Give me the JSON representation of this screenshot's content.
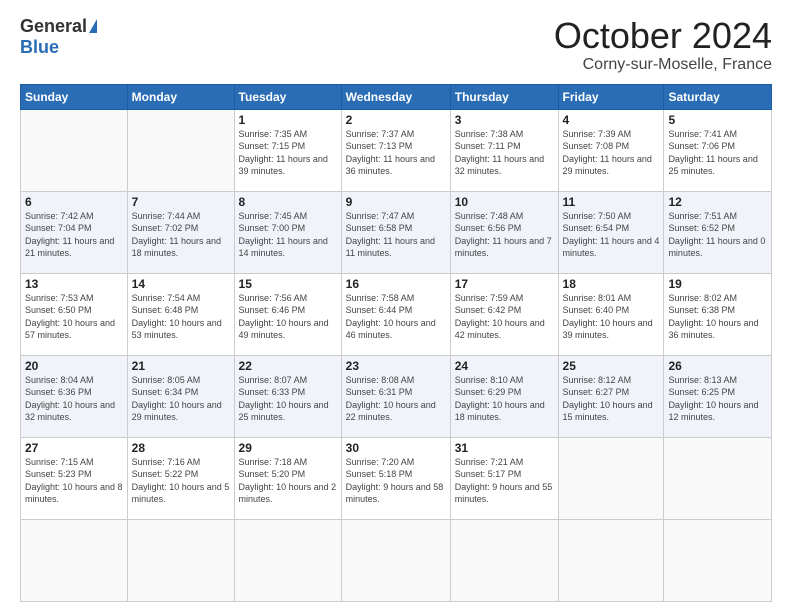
{
  "logo": {
    "general": "General",
    "blue": "Blue"
  },
  "header": {
    "month": "October 2024",
    "location": "Corny-sur-Moselle, France"
  },
  "weekdays": [
    "Sunday",
    "Monday",
    "Tuesday",
    "Wednesday",
    "Thursday",
    "Friday",
    "Saturday"
  ],
  "days": [
    {
      "num": "",
      "info": ""
    },
    {
      "num": "",
      "info": ""
    },
    {
      "num": "1",
      "info": "Sunrise: 7:35 AM\nSunset: 7:15 PM\nDaylight: 11 hours and 39 minutes."
    },
    {
      "num": "2",
      "info": "Sunrise: 7:37 AM\nSunset: 7:13 PM\nDaylight: 11 hours and 36 minutes."
    },
    {
      "num": "3",
      "info": "Sunrise: 7:38 AM\nSunset: 7:11 PM\nDaylight: 11 hours and 32 minutes."
    },
    {
      "num": "4",
      "info": "Sunrise: 7:39 AM\nSunset: 7:08 PM\nDaylight: 11 hours and 29 minutes."
    },
    {
      "num": "5",
      "info": "Sunrise: 7:41 AM\nSunset: 7:06 PM\nDaylight: 11 hours and 25 minutes."
    },
    {
      "num": "6",
      "info": "Sunrise: 7:42 AM\nSunset: 7:04 PM\nDaylight: 11 hours and 21 minutes."
    },
    {
      "num": "7",
      "info": "Sunrise: 7:44 AM\nSunset: 7:02 PM\nDaylight: 11 hours and 18 minutes."
    },
    {
      "num": "8",
      "info": "Sunrise: 7:45 AM\nSunset: 7:00 PM\nDaylight: 11 hours and 14 minutes."
    },
    {
      "num": "9",
      "info": "Sunrise: 7:47 AM\nSunset: 6:58 PM\nDaylight: 11 hours and 11 minutes."
    },
    {
      "num": "10",
      "info": "Sunrise: 7:48 AM\nSunset: 6:56 PM\nDaylight: 11 hours and 7 minutes."
    },
    {
      "num": "11",
      "info": "Sunrise: 7:50 AM\nSunset: 6:54 PM\nDaylight: 11 hours and 4 minutes."
    },
    {
      "num": "12",
      "info": "Sunrise: 7:51 AM\nSunset: 6:52 PM\nDaylight: 11 hours and 0 minutes."
    },
    {
      "num": "13",
      "info": "Sunrise: 7:53 AM\nSunset: 6:50 PM\nDaylight: 10 hours and 57 minutes."
    },
    {
      "num": "14",
      "info": "Sunrise: 7:54 AM\nSunset: 6:48 PM\nDaylight: 10 hours and 53 minutes."
    },
    {
      "num": "15",
      "info": "Sunrise: 7:56 AM\nSunset: 6:46 PM\nDaylight: 10 hours and 49 minutes."
    },
    {
      "num": "16",
      "info": "Sunrise: 7:58 AM\nSunset: 6:44 PM\nDaylight: 10 hours and 46 minutes."
    },
    {
      "num": "17",
      "info": "Sunrise: 7:59 AM\nSunset: 6:42 PM\nDaylight: 10 hours and 42 minutes."
    },
    {
      "num": "18",
      "info": "Sunrise: 8:01 AM\nSunset: 6:40 PM\nDaylight: 10 hours and 39 minutes."
    },
    {
      "num": "19",
      "info": "Sunrise: 8:02 AM\nSunset: 6:38 PM\nDaylight: 10 hours and 36 minutes."
    },
    {
      "num": "20",
      "info": "Sunrise: 8:04 AM\nSunset: 6:36 PM\nDaylight: 10 hours and 32 minutes."
    },
    {
      "num": "21",
      "info": "Sunrise: 8:05 AM\nSunset: 6:34 PM\nDaylight: 10 hours and 29 minutes."
    },
    {
      "num": "22",
      "info": "Sunrise: 8:07 AM\nSunset: 6:33 PM\nDaylight: 10 hours and 25 minutes."
    },
    {
      "num": "23",
      "info": "Sunrise: 8:08 AM\nSunset: 6:31 PM\nDaylight: 10 hours and 22 minutes."
    },
    {
      "num": "24",
      "info": "Sunrise: 8:10 AM\nSunset: 6:29 PM\nDaylight: 10 hours and 18 minutes."
    },
    {
      "num": "25",
      "info": "Sunrise: 8:12 AM\nSunset: 6:27 PM\nDaylight: 10 hours and 15 minutes."
    },
    {
      "num": "26",
      "info": "Sunrise: 8:13 AM\nSunset: 6:25 PM\nDaylight: 10 hours and 12 minutes."
    },
    {
      "num": "27",
      "info": "Sunrise: 7:15 AM\nSunset: 5:23 PM\nDaylight: 10 hours and 8 minutes."
    },
    {
      "num": "28",
      "info": "Sunrise: 7:16 AM\nSunset: 5:22 PM\nDaylight: 10 hours and 5 minutes."
    },
    {
      "num": "29",
      "info": "Sunrise: 7:18 AM\nSunset: 5:20 PM\nDaylight: 10 hours and 2 minutes."
    },
    {
      "num": "30",
      "info": "Sunrise: 7:20 AM\nSunset: 5:18 PM\nDaylight: 9 hours and 58 minutes."
    },
    {
      "num": "31",
      "info": "Sunrise: 7:21 AM\nSunset: 5:17 PM\nDaylight: 9 hours and 55 minutes."
    },
    {
      "num": "",
      "info": ""
    },
    {
      "num": "",
      "info": ""
    }
  ]
}
